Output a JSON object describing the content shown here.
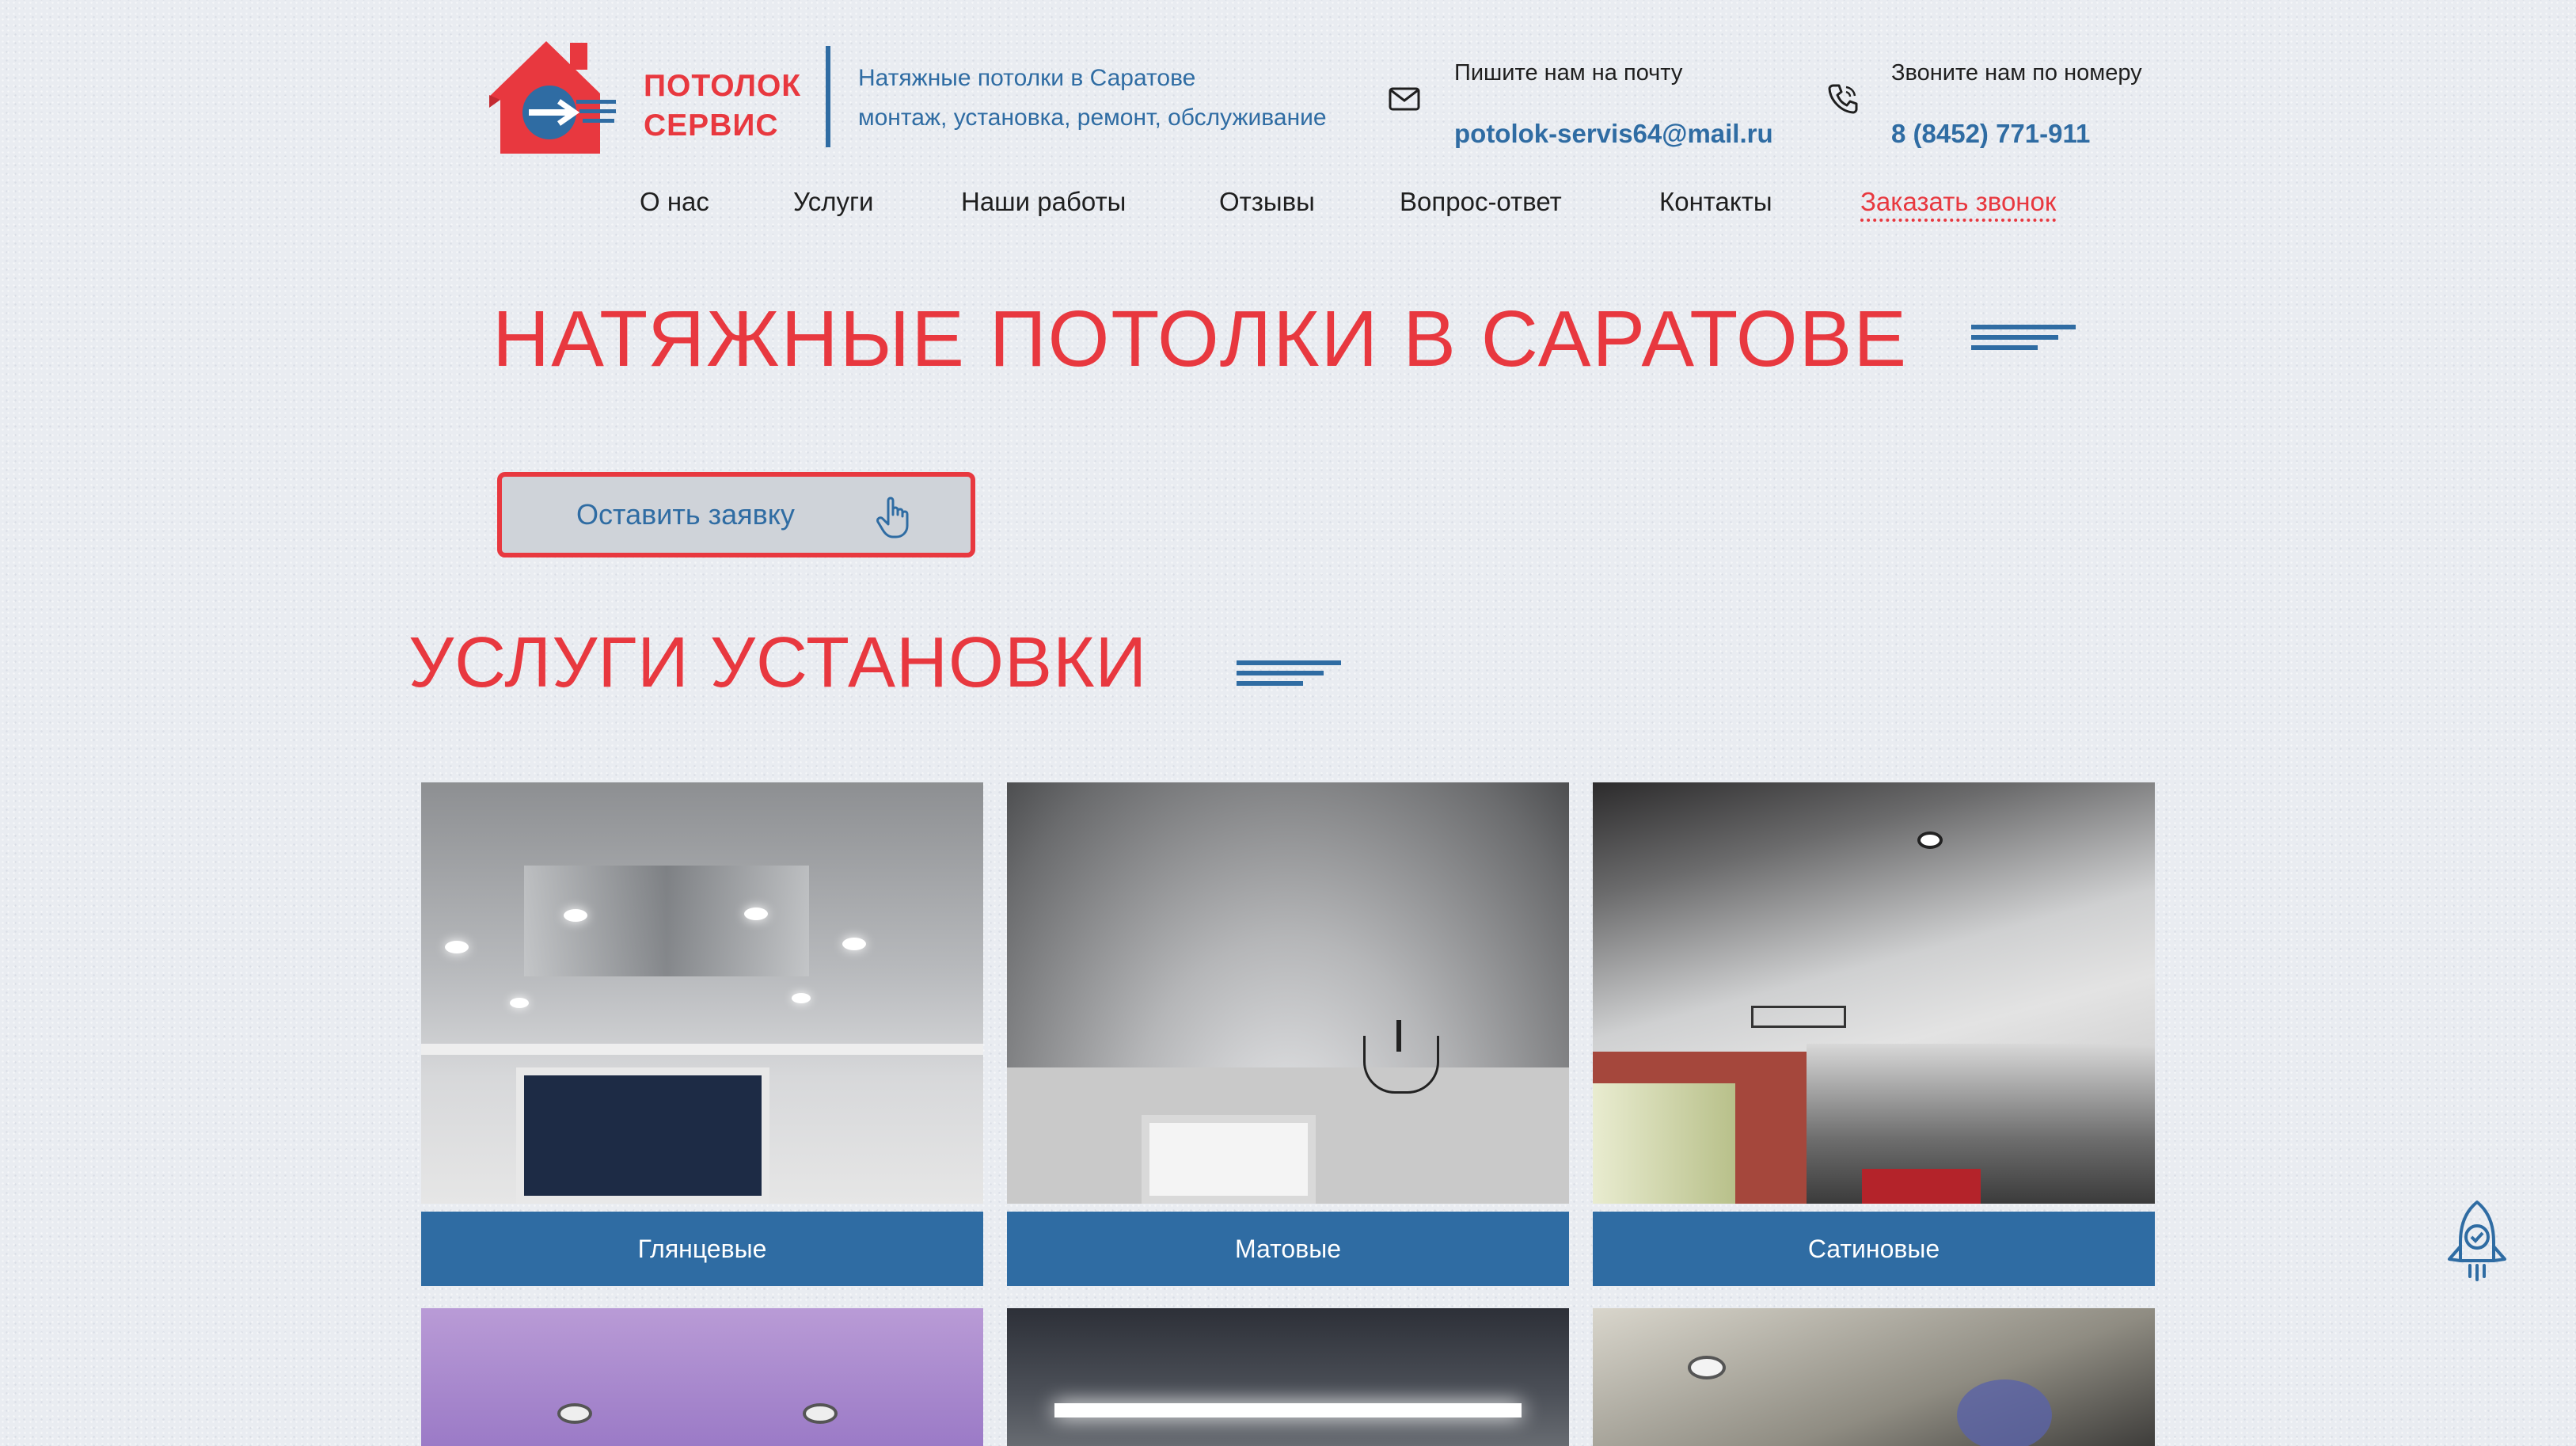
{
  "header": {
    "logo_line1": "ПОТОЛОК",
    "logo_line2": "СЕРВИС",
    "tagline_line1": "Натяжные потолки в Саратове",
    "tagline_line2": "монтаж, установка, ремонт, обслуживание",
    "mail_caption": "Пишите нам на почту",
    "mail_value": "potolok-servis64@mail.ru",
    "phone_caption": "Звоните нам по номеру",
    "phone_value": "8 (8452) 771-911",
    "icons": {
      "mail": "envelope-icon",
      "phone": "phone-icon"
    }
  },
  "nav": {
    "items": [
      "О нас",
      "Услуги",
      "Наши работы",
      "Отзывы",
      "Вопрос-ответ",
      "Контакты"
    ],
    "call_label": "Заказать звонок"
  },
  "hero": {
    "title": "НАТЯЖНЫЕ ПОТОЛКИ В САРАТОВЕ",
    "cta_label": "Оставить заявку"
  },
  "services": {
    "title": "УСЛУГИ УСТАНОВКИ",
    "cards": [
      {
        "label": "Глянцевые"
      },
      {
        "label": "Матовые"
      },
      {
        "label": "Сатиновые"
      }
    ]
  },
  "colors": {
    "accent_red": "#e8383f",
    "brand_blue": "#2f6ca3",
    "background": "#e9ecf1"
  }
}
